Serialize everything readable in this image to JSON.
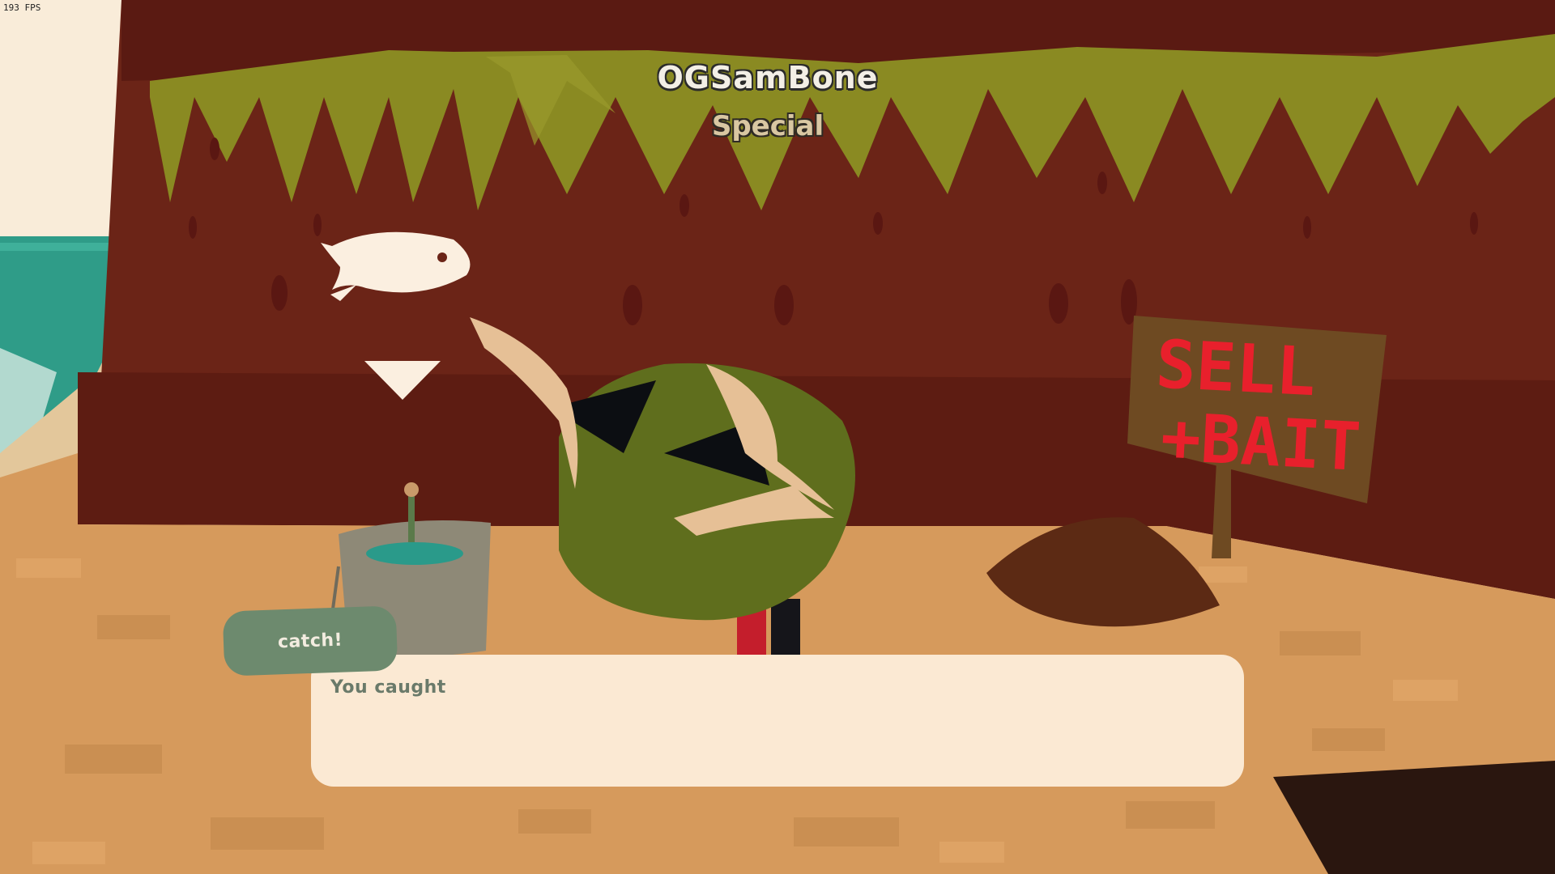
{
  "hud": {
    "fps": "193 FPS"
  },
  "player": {
    "name": "OGSamBone",
    "title": "Special"
  },
  "scene": {
    "sign_lines": [
      "SELL",
      "+BAIT"
    ],
    "fish_icon": "fish-icon",
    "pointer_icon": "down-triangle-icon"
  },
  "dialog": {
    "speaker": "catch!",
    "text": "You caught"
  },
  "colors": {
    "sky": "#f9ecd9",
    "ocean": "#2f9c88",
    "cliff": "#6b2417",
    "cliff_dark": "#5a1a12",
    "moss": "#8a8a22",
    "sand": "#d69a5c",
    "sign_board": "#6e4a22",
    "sign_text": "#e8202c",
    "dialog_bg": "#fbe9d3",
    "speaker_bg": "#6d8a6e",
    "player_coat": "#5f6e1d"
  }
}
